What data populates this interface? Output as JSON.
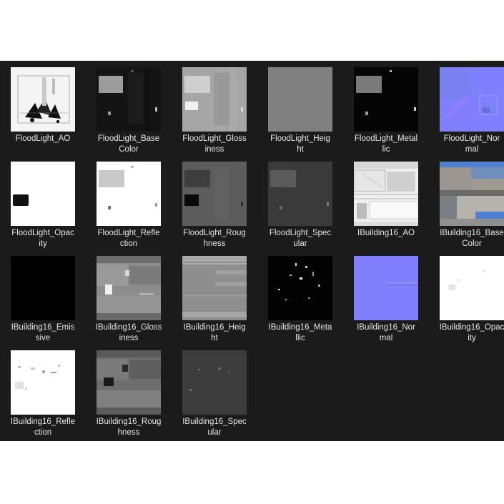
{
  "explorer": {
    "items": [
      {
        "line1": "FloodLight_AO",
        "line2": "",
        "thumb": "floodlight-ao"
      },
      {
        "line1": "FloodLight_Base",
        "line2": "Color",
        "thumb": "floodlight-basecolor"
      },
      {
        "line1": "FloodLight_Gloss",
        "line2": "iness",
        "thumb": "floodlight-glossiness"
      },
      {
        "line1": "FloodLight_Heig",
        "line2": "ht",
        "thumb": "floodlight-height"
      },
      {
        "line1": "FloodLight_Metal",
        "line2": "lic",
        "thumb": "floodlight-metallic"
      },
      {
        "line1": "FloodLight_Nor",
        "line2": "mal",
        "thumb": "floodlight-normal"
      },
      {
        "line1": "FloodLight_Opac",
        "line2": "ity",
        "thumb": "floodlight-opacity"
      },
      {
        "line1": "FloodLight_Refle",
        "line2": "ction",
        "thumb": "floodlight-reflection"
      },
      {
        "line1": "FloodLight_Roug",
        "line2": "hness",
        "thumb": "floodlight-roughness"
      },
      {
        "line1": "FloodLight_Spec",
        "line2": "ular",
        "thumb": "floodlight-specular"
      },
      {
        "line1": "IBuilding16_AO",
        "line2": "",
        "thumb": "ibuilding-ao"
      },
      {
        "line1": "IBuilding16_Base",
        "line2": "Color",
        "thumb": "ibuilding-basecolor"
      },
      {
        "line1": "IBuilding16_Emis",
        "line2": "sive",
        "thumb": "ibuilding-emissive"
      },
      {
        "line1": "IBuilding16_Gloss",
        "line2": "iness",
        "thumb": "ibuilding-glossiness"
      },
      {
        "line1": "IBuilding16_Heig",
        "line2": "ht",
        "thumb": "ibuilding-height"
      },
      {
        "line1": "IBuilding16_Meta",
        "line2": "llic",
        "thumb": "ibuilding-metallic"
      },
      {
        "line1": "IBuilding16_Nor",
        "line2": "mal",
        "thumb": "ibuilding-normal"
      },
      {
        "line1": "IBuilding16_Opac",
        "line2": "ity",
        "thumb": "ibuilding-opacity"
      },
      {
        "line1": "IBuilding16_Refle",
        "line2": "ction",
        "thumb": "ibuilding-reflection"
      },
      {
        "line1": "IBuilding16_Roug",
        "line2": "hness",
        "thumb": "ibuilding-roughness"
      },
      {
        "line1": "IBuilding16_Spec",
        "line2": "ular",
        "thumb": "ibuilding-specular"
      }
    ]
  },
  "colors": {
    "panel_bg": "#1b1b1b",
    "label_text": "#e6e6e6",
    "normal_map": "#8080ff"
  }
}
